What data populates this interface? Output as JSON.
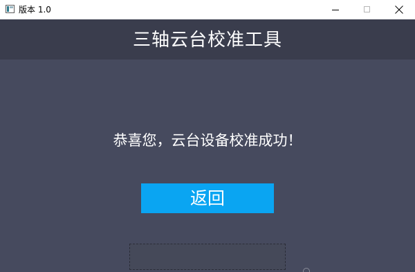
{
  "window": {
    "title": "版本 1.0",
    "icon": "app-icon",
    "controls": [
      "minimize-icon",
      "maximize-icon",
      "close-icon"
    ]
  },
  "header": {
    "title": "三轴云台校准工具"
  },
  "main": {
    "message": "恭喜您，云台设备校准成功！",
    "back_button_label": "返回"
  },
  "colors": {
    "header_bg": "#3a3d4d",
    "body_bg": "#464a5e",
    "button_bg": "#0aa5f2",
    "text": "#ffffff"
  }
}
